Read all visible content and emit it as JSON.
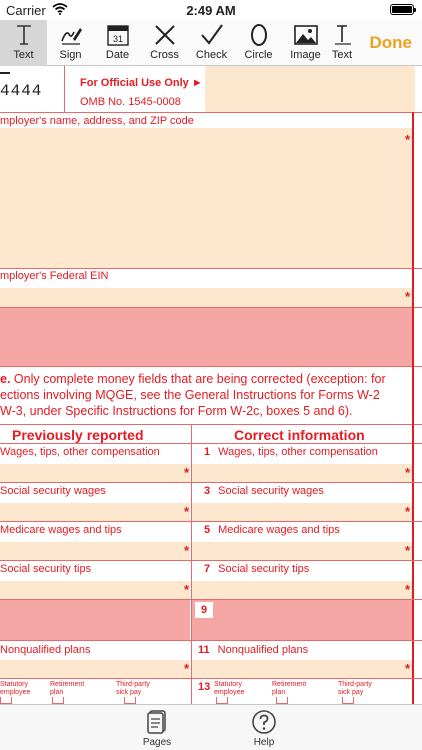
{
  "status_bar": {
    "carrier": "Carrier",
    "time": "2:49 AM"
  },
  "toolbar": {
    "tools": [
      {
        "label": "Text",
        "icon": "text-cursor-icon"
      },
      {
        "label": "Sign",
        "icon": "signature-icon"
      },
      {
        "label": "Date",
        "icon": "calendar-icon",
        "day": "31"
      },
      {
        "label": "Cross",
        "icon": "cross-icon"
      },
      {
        "label": "Check",
        "icon": "checkmark-icon"
      },
      {
        "label": "Circle",
        "icon": "circle-icon"
      },
      {
        "label": "Image",
        "icon": "image-icon"
      },
      {
        "label": "Text",
        "icon": "text-stamp-icon"
      }
    ],
    "done_label": "Done",
    "accent": "#f0a020"
  },
  "form": {
    "form_code": "4444",
    "official_use": "For Official Use Only ►",
    "omb": "OMB No. 1545-0008",
    "employer_label": "mployer's name, address, and ZIP code",
    "ein_label": "mployer's Federal EIN",
    "note": {
      "lead": "e.",
      "lines": [
        " Only complete money fields that are being corrected (exception: for",
        "ections involving MQGE, see the General Instructions for Forms W-2",
        "W-3, under Specific Instructions for Form W-2c, boxes 5 and 6)."
      ]
    },
    "col_prev": "Previously reported",
    "col_correct": "Correct information",
    "rows": [
      {
        "left": "Wages, tips, other compensation",
        "right_num": "1",
        "right": "Wages, tips, other compensation"
      },
      {
        "left": "Social security wages",
        "right_num": "3",
        "right": "Social security wages"
      },
      {
        "left": "Medicare wages and tips",
        "right_num": "5",
        "right": "Medicare wages and tips"
      },
      {
        "left": "Social security tips",
        "right_num": "7",
        "right": "Social security tips"
      }
    ],
    "box9": "9",
    "row11": {
      "left": "Nonqualified plans",
      "right_num": "11",
      "right": "Nonqualified plans"
    },
    "row13": {
      "right_num": "13",
      "statutory": [
        "Statutory",
        "employee"
      ],
      "retirement": [
        "Retirement",
        "plan"
      ],
      "thirdparty": [
        "Third-party",
        "sick pay"
      ]
    },
    "required_mark": "*",
    "colors": {
      "line": "#e36b6b",
      "fill": "#fde7cf",
      "shaded": "#f7a6a6",
      "text": "#e31b23"
    }
  },
  "tabbar": {
    "pages_label": "Pages",
    "help_label": "Help"
  }
}
